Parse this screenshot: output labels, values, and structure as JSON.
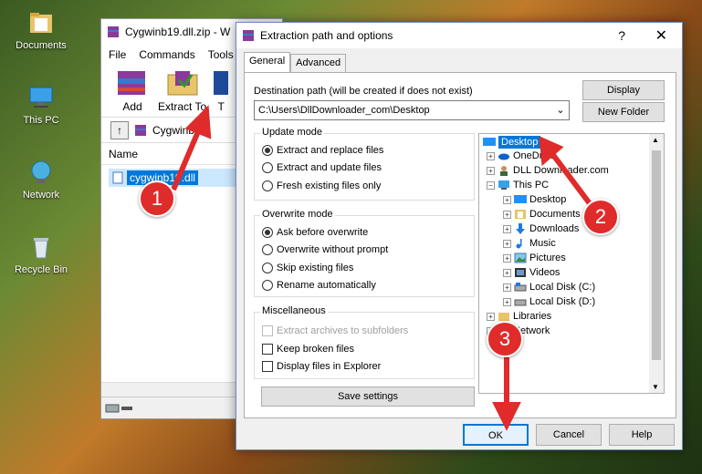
{
  "desktop": {
    "icons": [
      {
        "label": "Documents",
        "icon": "folder-icon"
      },
      {
        "label": "This PC",
        "icon": "computer-icon"
      },
      {
        "label": "Network",
        "icon": "network-icon"
      },
      {
        "label": "Recycle Bin",
        "icon": "recycle-bin-icon"
      }
    ]
  },
  "winrar": {
    "title": "Cygwinb19.dll.zip - W",
    "menu": [
      "File",
      "Commands",
      "Tools"
    ],
    "toolbar": {
      "add_label": "Add",
      "extract_label": "Extract To",
      "third_label": "T"
    },
    "path": "Cygwinb19",
    "column_name": "Name",
    "file": "cygwinb19.dll"
  },
  "dialog": {
    "title": "Extraction path and options",
    "help": "?",
    "close": "✕",
    "tabs": [
      "General",
      "Advanced"
    ],
    "destination_label": "Destination path (will be created if does not exist)",
    "destination_value": "C:\\Users\\DllDownloader_com\\Desktop",
    "display_button": "Display",
    "new_folder_button": "New Folder",
    "update_mode": {
      "title": "Update mode",
      "options": [
        "Extract and replace files",
        "Extract and update files",
        "Fresh existing files only"
      ],
      "selected": 0
    },
    "overwrite_mode": {
      "title": "Overwrite mode",
      "options": [
        "Ask before overwrite",
        "Overwrite without prompt",
        "Skip existing files",
        "Rename automatically"
      ],
      "selected": 0
    },
    "misc": {
      "title": "Miscellaneous",
      "options": [
        "Extract archives to subfolders",
        "Keep broken files",
        "Display files in Explorer"
      ]
    },
    "save_settings": "Save settings",
    "tree": [
      {
        "label": "Desktop",
        "level": 0,
        "selected": true,
        "exp": "",
        "icon": "desktop-icon"
      },
      {
        "label": "OneDrive",
        "level": 1,
        "exp": "+",
        "icon": "onedrive-icon"
      },
      {
        "label": "DLL Downloader.com",
        "level": 1,
        "exp": "+",
        "icon": "user-icon"
      },
      {
        "label": "This PC",
        "level": 1,
        "exp": "−",
        "icon": "computer-icon"
      },
      {
        "label": "Desktop",
        "level": 2,
        "exp": "+",
        "icon": "desktop-icon"
      },
      {
        "label": "Documents",
        "level": 2,
        "exp": "+",
        "icon": "documents-icon"
      },
      {
        "label": "Downloads",
        "level": 2,
        "exp": "+",
        "icon": "downloads-icon"
      },
      {
        "label": "Music",
        "level": 2,
        "exp": "+",
        "icon": "music-icon"
      },
      {
        "label": "Pictures",
        "level": 2,
        "exp": "+",
        "icon": "pictures-icon"
      },
      {
        "label": "Videos",
        "level": 2,
        "exp": "+",
        "icon": "videos-icon"
      },
      {
        "label": "Local Disk (C:)",
        "level": 2,
        "exp": "+",
        "icon": "disk-icon"
      },
      {
        "label": "Local Disk (D:)",
        "level": 2,
        "exp": "+",
        "icon": "disk-icon"
      },
      {
        "label": "Libraries",
        "level": 1,
        "exp": "+",
        "icon": "libraries-icon"
      },
      {
        "label": "Network",
        "level": 1,
        "exp": "+",
        "icon": "network-icon"
      }
    ],
    "ok": "OK",
    "cancel": "Cancel",
    "help_button": "Help"
  },
  "annotations": [
    "1",
    "2",
    "3"
  ],
  "colors": {
    "accent": "#0078d7",
    "badge": "#e02b2b"
  }
}
